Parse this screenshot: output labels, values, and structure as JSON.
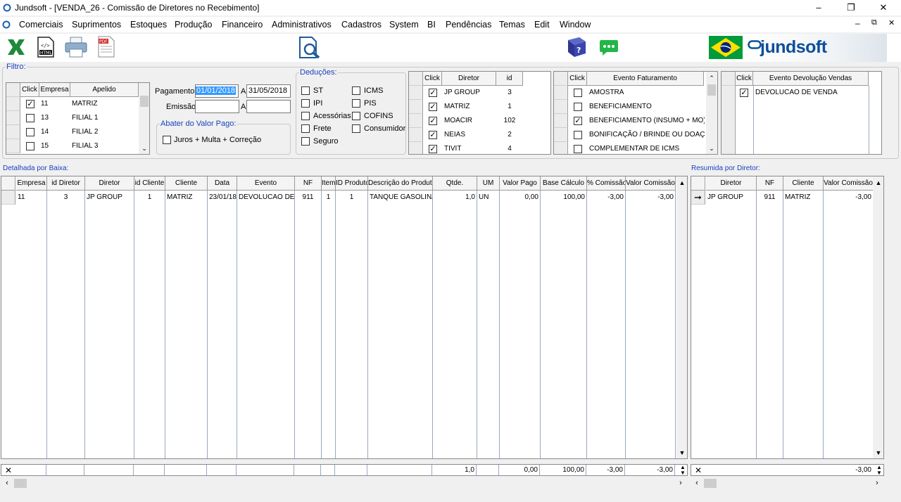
{
  "window": {
    "title": "Jundsoft - [VENDA_26 - Comissão de Diretores no Recebimento]",
    "min": "–",
    "max": "❐",
    "close": "✕",
    "child_min": "–",
    "child_restore": "⧉",
    "child_close": "✕"
  },
  "menu": [
    "Comerciais",
    "Suprimentos",
    "Estoques",
    "Produção",
    "Financeiro",
    "Administrativos",
    "Cadastros",
    "System",
    "BI",
    "Pendências",
    "Temas",
    "Edit",
    "Window"
  ],
  "brand": {
    "logo_text": "jundsoft"
  },
  "toolbar_icons": [
    "excel-icon",
    "html-icon",
    "print-icon",
    "pdf-icon",
    "preview-search-icon",
    "help-book-icon",
    "chat-icon",
    "brazil-flag-icon"
  ],
  "filter": {
    "legend": "Filtro:",
    "company_grid": {
      "headers": [
        "Click",
        "Empresa",
        "Apelido"
      ],
      "rows": [
        {
          "checked": true,
          "empresa": "11",
          "apelido": "MATRIZ"
        },
        {
          "checked": false,
          "empresa": "13",
          "apelido": "FILIAL 1"
        },
        {
          "checked": false,
          "empresa": "14",
          "apelido": "FILIAL 2"
        },
        {
          "checked": false,
          "empresa": "15",
          "apelido": "FILIAL 3"
        }
      ]
    },
    "pagamentos_label": "Pagamentos:",
    "pag_from": "01/01/2018",
    "a_label": "A",
    "pag_to": "31/05/2018",
    "emissao_label": "Emissão:",
    "emissao_from": "",
    "emissao_to": "",
    "abater": {
      "legend": "Abater do Valor Pago:",
      "juros_label": "Juros + Multa + Correção",
      "juros_checked": false
    },
    "deducoes": {
      "legend": "Deduções:",
      "col1": [
        {
          "label": "ST",
          "checked": false
        },
        {
          "label": "IPI",
          "checked": false
        },
        {
          "label": "Acessórias",
          "checked": false
        },
        {
          "label": "Frete",
          "checked": false
        },
        {
          "label": "Seguro",
          "checked": false
        }
      ],
      "col2": [
        {
          "label": "ICMS",
          "checked": false
        },
        {
          "label": "PIS",
          "checked": false
        },
        {
          "label": "COFINS",
          "checked": false
        },
        {
          "label": "Consumidor",
          "checked": false
        }
      ]
    }
  },
  "director_grid": {
    "headers": [
      "Click",
      "Diretor",
      "id"
    ],
    "rows": [
      {
        "checked": true,
        "nome": "JP GROUP",
        "id": "3"
      },
      {
        "checked": true,
        "nome": "MATRIZ",
        "id": "1"
      },
      {
        "checked": true,
        "nome": "MOACIR",
        "id": "102"
      },
      {
        "checked": true,
        "nome": "NEIAS",
        "id": "2"
      },
      {
        "checked": true,
        "nome": "TIVIT",
        "id": "4"
      }
    ]
  },
  "evento_grid": {
    "headers": [
      "Click",
      "Evento Faturamento"
    ],
    "rows": [
      {
        "checked": false,
        "evento": "AMOSTRA"
      },
      {
        "checked": false,
        "evento": "BENEFICIAMENTO"
      },
      {
        "checked": true,
        "evento": "BENEFICIAMENTO (INSUMO + MO)"
      },
      {
        "checked": false,
        "evento": "BONIFICAÇÃO / BRINDE OU DOAÇÃO"
      },
      {
        "checked": false,
        "evento": "COMPLEMENTAR DE ICMS"
      }
    ]
  },
  "devolucao_grid": {
    "headers": [
      "Click",
      "Evento Devolução Vendas"
    ],
    "rows": [
      {
        "checked": true,
        "evento": "DEVOLUCAO DE VENDA"
      }
    ]
  },
  "detalhada": {
    "label": "Detalhada por Baixa:",
    "headers": [
      "Empresa",
      "id Diretor",
      "Diretor",
      "id Cliente",
      "Cliente",
      "Data",
      "Evento",
      "NF",
      "Item",
      "ID Produto",
      "Descrição do Produto",
      "Qtde.",
      "UM",
      "Valor Pago",
      "Base Cálculo",
      "% Comissão",
      "Valor Comissão"
    ],
    "rows": [
      [
        "11",
        "3",
        "JP GROUP",
        "1",
        "MATRIZ",
        "23/01/18",
        "DEVOLUCAO DE VENDA",
        "911",
        "1",
        "1",
        "TANQUE GASOLINA",
        "1,0",
        "UN",
        "0,00",
        "100,00",
        "-3,00",
        "-3,00"
      ]
    ],
    "totals": {
      "qtde": "1,0",
      "valor_pago": "0,00",
      "base": "100,00",
      "pct": "-3,00",
      "comissao": "-3,00"
    }
  },
  "resumida": {
    "label": "Resumida por Diretor:",
    "headers": [
      "Diretor",
      "NF",
      "Cliente",
      "Valor Comissão"
    ],
    "rows": [
      [
        "JP GROUP",
        "911",
        "MATRIZ",
        "-3,00"
      ]
    ],
    "totals": {
      "comissao": "-3,00"
    }
  },
  "colors": {
    "accent": "#1a3fbf",
    "selection": "#3399ff",
    "flag_green": "#009b3a",
    "flag_yellow": "#fedf00",
    "flag_blue": "#002776"
  }
}
